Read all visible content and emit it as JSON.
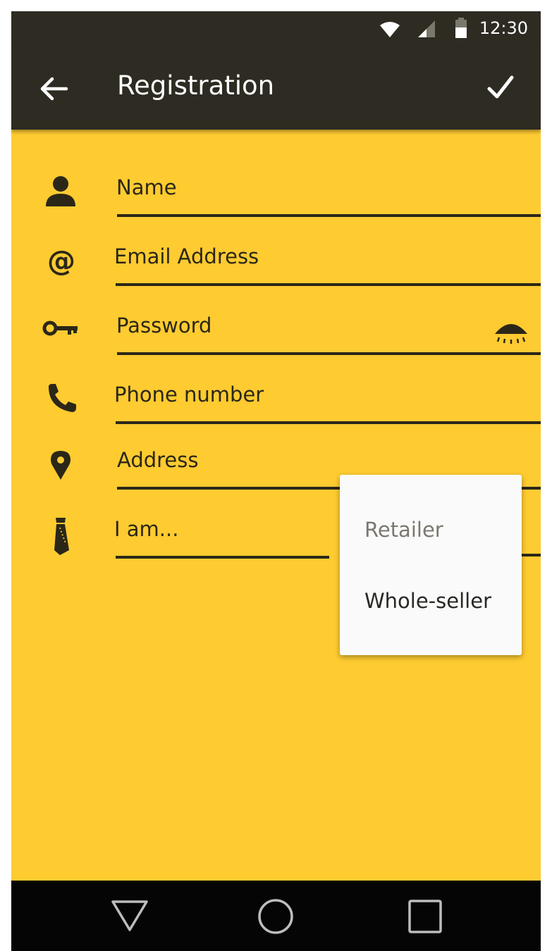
{
  "status_bar": {
    "time": "12:30",
    "icons": [
      "wifi-icon",
      "signal-icon",
      "battery-icon"
    ]
  },
  "app_bar": {
    "title": "Registration",
    "back_icon": "arrow-left-icon",
    "confirm_icon": "check-icon"
  },
  "form": {
    "fields": [
      {
        "label": "Name",
        "icon": "person-icon"
      },
      {
        "label": "Email Address",
        "icon": "at-icon"
      },
      {
        "label": "Password",
        "icon": "key-icon",
        "trailing_icon": "eye-icon"
      },
      {
        "label": "Phone number",
        "icon": "phone-icon"
      },
      {
        "label": "Address",
        "icon": "location-pin-icon"
      },
      {
        "label": "I am...",
        "icon": "tie-icon"
      }
    ]
  },
  "dropdown": {
    "options": [
      "Retailer",
      "Whole-seller"
    ]
  },
  "nav_bar": {
    "icons": [
      "back-triangle-icon",
      "home-circle-icon",
      "recents-square-icon"
    ]
  },
  "colors": {
    "background": "#fecb31",
    "app_bar": "#2e2b22",
    "nav_bar": "#050505",
    "text_dark": "#2b2718",
    "dropdown_bg": "#fafafa",
    "dropdown_muted": "#7b7870"
  }
}
